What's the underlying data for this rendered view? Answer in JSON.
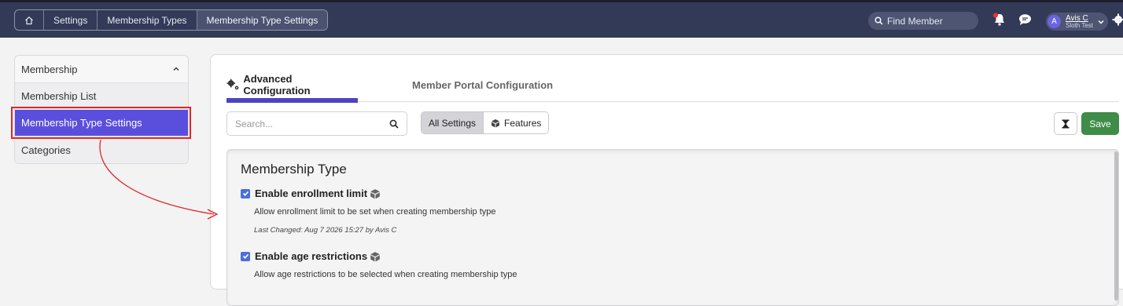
{
  "breadcrumb": {
    "home_icon": "home-icon",
    "items": [
      "Settings",
      "Membership Types",
      "Membership Type Settings"
    ]
  },
  "header": {
    "search_placeholder": "Find Member",
    "user": {
      "initial": "A",
      "name": "Avis C",
      "subtitle": "Sloth Test"
    }
  },
  "sidebar": {
    "group_label": "Membership",
    "items": [
      {
        "label": "Membership List"
      },
      {
        "label": "Membership Type Settings"
      },
      {
        "label": "Categories"
      }
    ]
  },
  "tabs": {
    "advanced": "Advanced Configuration",
    "portal": "Member Portal Configuration"
  },
  "toolbar": {
    "search_placeholder": "Search...",
    "all_settings": "All Settings",
    "features": "Features",
    "save": "Save"
  },
  "section": {
    "title": "Membership Type",
    "settings": [
      {
        "title": "Enable enrollment limit",
        "description": "Allow enrollment limit to be set when creating membership type",
        "last_changed": "Last Changed: Aug 7 2026 15:27 by Avis C",
        "checked": true
      },
      {
        "title": "Enable age restrictions",
        "description": "Allow age restrictions to be selected when creating membership type",
        "checked": true
      }
    ]
  },
  "colors": {
    "topbar": "#323a58",
    "accent": "#5a4fdc",
    "save": "#3f8c48",
    "annotation": "#e02626"
  }
}
